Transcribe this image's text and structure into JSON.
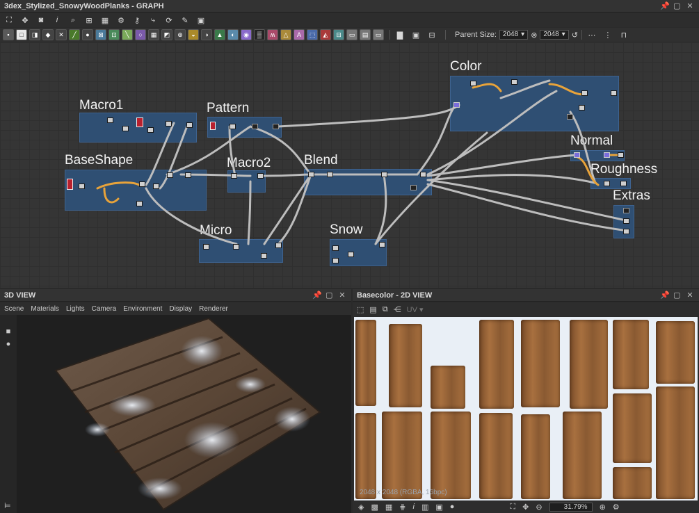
{
  "graph": {
    "title": "3dex_Stylized_SnowyWoodPlanks - GRAPH",
    "parent_size_label": "Parent Size:",
    "size_w": "2048",
    "size_h": "2048",
    "frames": [
      {
        "label": "Macro1"
      },
      {
        "label": "Pattern"
      },
      {
        "label": "BaseShape"
      },
      {
        "label": "Macro2"
      },
      {
        "label": "Blend"
      },
      {
        "label": "Color"
      },
      {
        "label": "Normal"
      },
      {
        "label": "Roughness"
      },
      {
        "label": "Extras"
      },
      {
        "label": "Micro"
      },
      {
        "label": "Snow"
      }
    ]
  },
  "view3d": {
    "title": "3D VIEW",
    "menu": [
      "Scene",
      "Materials",
      "Lights",
      "Camera",
      "Environment",
      "Display",
      "Renderer"
    ]
  },
  "view2d": {
    "title": "Basecolor - 2D VIEW",
    "uv_label": "UV",
    "image_info": "2048 x 2048 (RGBA, 16bpc)",
    "zoom": "31.79%"
  },
  "colors": {
    "frame_fill": "#2f4f73",
    "wire_gray": "#bdbdbd",
    "wire_orange": "#e8a33a"
  }
}
